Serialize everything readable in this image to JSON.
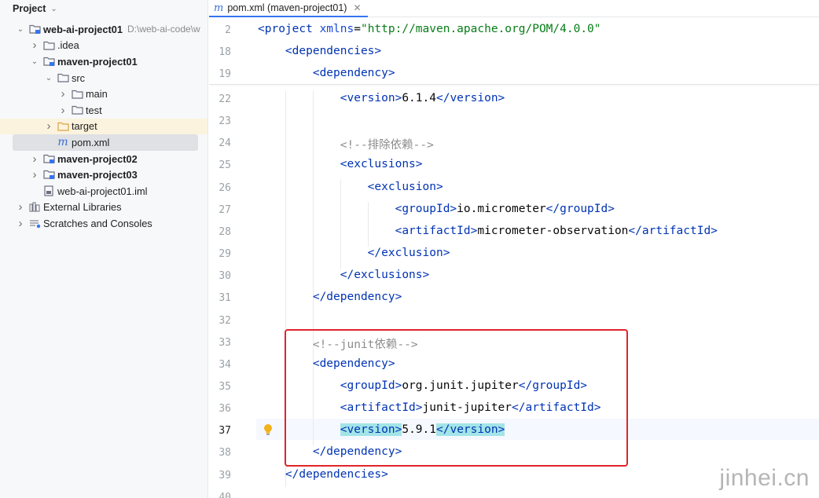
{
  "project_panel": {
    "title": "Project",
    "tree": [
      {
        "label": "web-ai-project01",
        "path": "D:\\web-ai-code\\w",
        "bold": true,
        "depth": 0,
        "arrow": "open",
        "icon": "module-folder-icon"
      },
      {
        "label": ".idea",
        "depth": 1,
        "arrow": "closed",
        "icon": "folder-icon"
      },
      {
        "label": "maven-project01",
        "bold": true,
        "depth": 1,
        "arrow": "open",
        "icon": "module-folder-icon"
      },
      {
        "label": "src",
        "depth": 2,
        "arrow": "open",
        "icon": "folder-icon"
      },
      {
        "label": "main",
        "depth": 3,
        "arrow": "closed",
        "icon": "folder-icon"
      },
      {
        "label": "test",
        "depth": 3,
        "arrow": "closed",
        "icon": "folder-icon"
      },
      {
        "label": "target",
        "depth": 2,
        "arrow": "closed",
        "icon": "folder-orange-icon",
        "state": "excluded-highlight"
      },
      {
        "label": "pom.xml",
        "depth": 2,
        "arrow": "none",
        "icon": "maven-file-icon",
        "state": "selected"
      },
      {
        "label": "maven-project02",
        "bold": true,
        "depth": 1,
        "arrow": "closed",
        "icon": "module-folder-icon"
      },
      {
        "label": "maven-project03",
        "bold": true,
        "depth": 1,
        "arrow": "closed",
        "icon": "module-folder-icon"
      },
      {
        "label": "web-ai-project01.iml",
        "depth": 1,
        "arrow": "none",
        "icon": "iml-file-icon"
      },
      {
        "label": "External Libraries",
        "depth": 0,
        "arrow": "closed",
        "icon": "libraries-icon"
      },
      {
        "label": "Scratches and Consoles",
        "depth": 0,
        "arrow": "closed",
        "icon": "scratches-icon"
      }
    ]
  },
  "editor": {
    "tab_label": "pom.xml (maven-project01)",
    "sticky_lines": [
      {
        "n": "2",
        "tokens": [
          [
            "tag",
            "<project "
          ],
          [
            "attr",
            "xmlns"
          ],
          [
            "txt",
            "="
          ],
          [
            "str",
            "\"http://maven.apache.org/POM/4.0.0\""
          ]
        ]
      },
      {
        "n": "18",
        "tokens": [
          [
            "tag",
            "    <dependencies>"
          ]
        ]
      },
      {
        "n": "19",
        "tokens": [
          [
            "tag",
            "        <dependency>"
          ]
        ]
      }
    ],
    "lines": [
      {
        "n": "22",
        "tokens": [
          [
            "tag",
            "            <version>"
          ],
          [
            "txt",
            "6.1.4"
          ],
          [
            "tag",
            "</version>"
          ]
        ]
      },
      {
        "n": "23",
        "tokens": []
      },
      {
        "n": "24",
        "tokens": [
          [
            "cmt",
            "            <!--排除依赖-->"
          ]
        ]
      },
      {
        "n": "25",
        "tokens": [
          [
            "tag",
            "            <exclusions>"
          ]
        ]
      },
      {
        "n": "26",
        "tokens": [
          [
            "tag",
            "                <exclusion>"
          ]
        ]
      },
      {
        "n": "27",
        "tokens": [
          [
            "tag",
            "                    <groupId>"
          ],
          [
            "txt",
            "io.micrometer"
          ],
          [
            "tag",
            "</groupId>"
          ]
        ]
      },
      {
        "n": "28",
        "tokens": [
          [
            "tag",
            "                    <artifactId>"
          ],
          [
            "txt",
            "micrometer-observation"
          ],
          [
            "tag",
            "</artifactId>"
          ]
        ]
      },
      {
        "n": "29",
        "tokens": [
          [
            "tag",
            "                </exclusion>"
          ]
        ]
      },
      {
        "n": "30",
        "tokens": [
          [
            "tag",
            "            </exclusions>"
          ]
        ]
      },
      {
        "n": "31",
        "tokens": [
          [
            "tag",
            "        </dependency>"
          ]
        ]
      },
      {
        "n": "32",
        "tokens": []
      },
      {
        "n": "33",
        "tokens": [
          [
            "cmt",
            "        <!--junit依赖-->"
          ]
        ]
      },
      {
        "n": "34",
        "tokens": [
          [
            "tag",
            "        <dependency>"
          ]
        ]
      },
      {
        "n": "35",
        "tokens": [
          [
            "tag",
            "            <groupId>"
          ],
          [
            "txt",
            "org.junit.jupiter"
          ],
          [
            "tag",
            "</groupId>"
          ]
        ]
      },
      {
        "n": "36",
        "tokens": [
          [
            "tag",
            "            <artifactId>"
          ],
          [
            "txt",
            "junit-jupiter"
          ],
          [
            "tag",
            "</artifactId>"
          ]
        ]
      },
      {
        "n": "37",
        "current": true,
        "tokens": [
          [
            "txt",
            "            "
          ],
          [
            "tag hl",
            "<version>"
          ],
          [
            "txt",
            "5.9.1"
          ],
          [
            "tag hl",
            "</version>"
          ]
        ]
      },
      {
        "n": "38",
        "tokens": [
          [
            "tag",
            "        </dependency>"
          ]
        ]
      },
      {
        "n": "39",
        "tokens": [
          [
            "tag",
            "    </dependencies>"
          ]
        ]
      },
      {
        "n": "40",
        "tokens": []
      }
    ]
  },
  "watermark": "jinhei.cn",
  "colors": {
    "accent": "#3574f0",
    "selection_box": "#e0242a",
    "tag": "#0033b3",
    "string": "#067d17",
    "comment": "#8c8c8c"
  }
}
